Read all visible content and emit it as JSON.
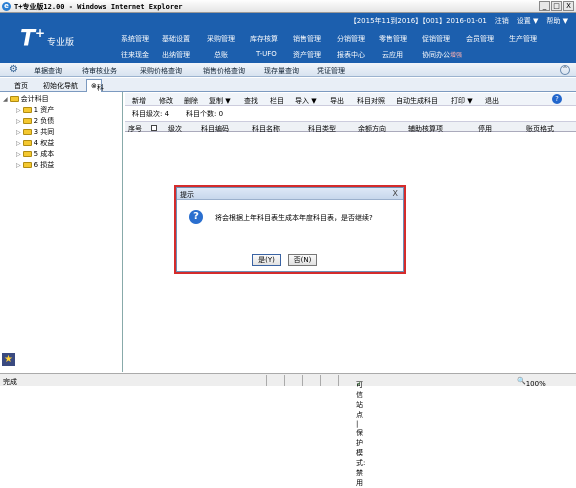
{
  "window": {
    "title": "T+专业版12.00 - Windows Internet Explorer",
    "minimize": "_",
    "maximize": "□",
    "close": "X"
  },
  "header": {
    "logo": "T",
    "logo_sup": "+",
    "edition": "专业版",
    "top_info": "【2015年11到2016】【001】2016-01-01",
    "logout": "注销",
    "settings": "设置 ▼",
    "help": "帮助 ▼",
    "modules_row1": [
      "系统管理",
      "基础设置",
      "采购管理",
      "库存核算",
      "销售管理",
      "分销管理",
      "零售管理",
      "促销管理",
      "会员管理",
      "生产管理"
    ],
    "modules_row2": [
      "往来现金",
      "出纳管理",
      "总账",
      "T-UFO",
      "资产管理",
      "报表中心",
      "云应用",
      "协同办公"
    ],
    "new_badge": "增强"
  },
  "navbar": {
    "items": [
      "单据查询",
      "待审核业务",
      "采购价格查询",
      "销售价格查询",
      "现存量查询",
      "凭证管理"
    ],
    "collapse": "^"
  },
  "tabs": [
    "首页",
    "初始化导航",
    "科目"
  ],
  "tree": {
    "root": "会计科目",
    "items": [
      "1 资产",
      "2 负债",
      "3 共同",
      "4 权益",
      "5 成本",
      "6 损益"
    ]
  },
  "toolbar": {
    "items": [
      "新增",
      "修改",
      "删除",
      "复制 ▼",
      "查找",
      "栏目",
      "导入 ▼",
      "导出",
      "科目对照",
      "自动生成科目",
      "打印 ▼",
      "退出"
    ],
    "help": "?"
  },
  "info": {
    "level": "科目级次:  4",
    "count": "科目个数:  0"
  },
  "columns": [
    "序号",
    "级次",
    "科目编码",
    "科目名称",
    "科目类型",
    "余额方向",
    "辅助核算项",
    "停用",
    "账页格式"
  ],
  "dialog": {
    "title": "提示",
    "close": "X",
    "message": "将会根据上年科目表生成本年度科目表，是否继续?",
    "yes": "是(Y)",
    "no": "否(N)",
    "icon": "?"
  },
  "statusbar": {
    "left": "完成",
    "trusted": "可信站点 | 保护模式: 禁用",
    "zoom": "100%"
  },
  "colors": {
    "header": "#1c5fae",
    "highlight": "#d42b2b"
  }
}
